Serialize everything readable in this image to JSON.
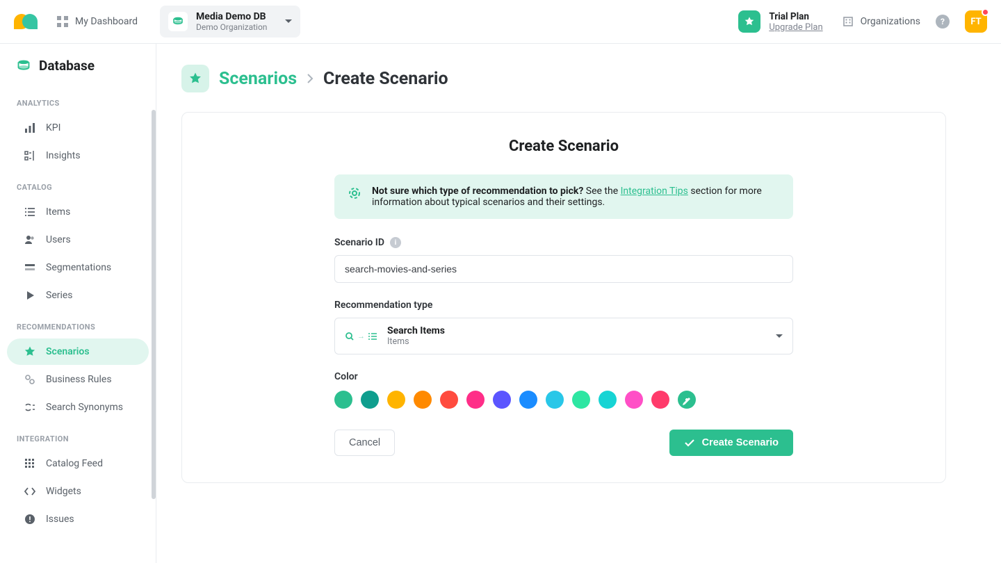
{
  "header": {
    "dashboard_label": "My Dashboard",
    "db": {
      "title": "Media Demo DB",
      "org": "Demo Organization"
    },
    "plan": {
      "title": "Trial Plan",
      "upgrade": "Upgrade Plan"
    },
    "organizations": "Organizations",
    "help_glyph": "?",
    "avatar": "FT"
  },
  "sidebar": {
    "title": "Database",
    "groups": {
      "analytics": "ANALYTICS",
      "catalog": "CATALOG",
      "recommendations": "RECOMMENDATIONS",
      "integration": "INTEGRATION"
    },
    "items": {
      "kpi": "KPI",
      "insights": "Insights",
      "items": "Items",
      "users": "Users",
      "segmentations": "Segmentations",
      "series": "Series",
      "scenarios": "Scenarios",
      "business_rules": "Business Rules",
      "search_synonyms": "Search Synonyms",
      "catalog_feed": "Catalog Feed",
      "widgets": "Widgets",
      "issues": "Issues"
    }
  },
  "breadcrumb": {
    "link": "Scenarios",
    "current": "Create Scenario"
  },
  "form": {
    "title": "Create Scenario",
    "hint_strong": "Not sure which type of recommendation to pick?",
    "hint_before_link": " See the ",
    "hint_link": "Integration Tips",
    "hint_after_link": " section for more information about typical scenarios and their settings.",
    "scenario_id_label": "Scenario ID",
    "scenario_id_value": "search-movies-and-series",
    "rec_type_label": "Recommendation type",
    "rec_type": {
      "title": "Search Items",
      "subtitle": "Items"
    },
    "color_label": "Color",
    "colors": [
      "#2cbf8f",
      "#0f9e8e",
      "#ffb400",
      "#ff8a00",
      "#ff4b3e",
      "#ff2e88",
      "#5b55ff",
      "#1a8cff",
      "#29c7e8",
      "#2ee6a2",
      "#17d4d4",
      "#ff4fc6",
      "#ff3b6b",
      "#2cbf8f"
    ],
    "cancel": "Cancel",
    "submit": "Create Scenario"
  }
}
